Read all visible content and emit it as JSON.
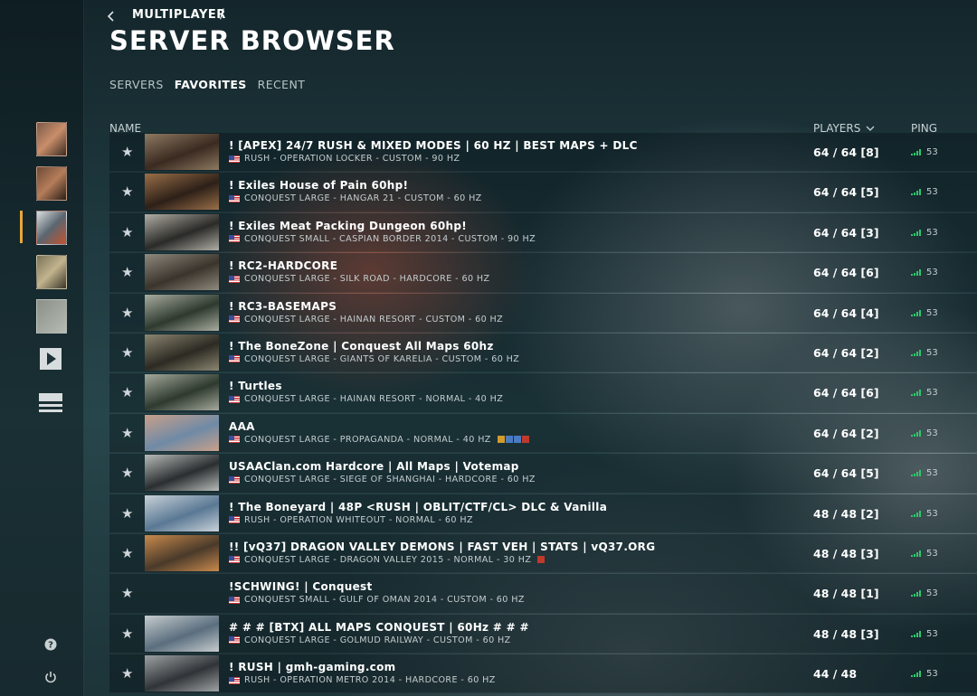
{
  "header": {
    "back_icon": "chevron-left-icon",
    "breadcrumb": "MULTIPLAYER",
    "breadcrumb_sep": "/",
    "title": "SERVER BROWSER"
  },
  "tabs": [
    {
      "label": "SERVERS",
      "active": false
    },
    {
      "label": "FAVORITES",
      "active": true
    },
    {
      "label": "RECENT",
      "active": false
    }
  ],
  "columns": {
    "name": "NAME",
    "players": "PLAYERS",
    "ping": "PING"
  },
  "sidebar": {
    "avatars": [
      {
        "name": "soldier-avatar-1",
        "color": "#7a5a4a"
      },
      {
        "name": "soldier-avatar-2",
        "color": "#6e4a38"
      },
      {
        "name": "soldier-avatar-3",
        "color": "#5a6670",
        "active": true
      },
      {
        "name": "soldier-avatar-4",
        "color": "#7b7258"
      },
      {
        "name": "emblem-avatar",
        "color": "#8a8f88"
      }
    ],
    "icons": [
      "play-icon",
      "menu-icon",
      "help-icon",
      "power-icon"
    ]
  },
  "servers": [
    {
      "name": "!  [APEX] 24/7 RUSH & MIXED MODES | 60 HZ | BEST MAPS + DLC",
      "meta": "RUSH - OPERATION LOCKER - CUSTOM - 90 HZ",
      "players": "64 / 64 [8]",
      "ping": "53",
      "thumb": [
        "#3a2a20",
        "#8d7a62"
      ]
    },
    {
      "name": "! Exiles House of Pain 60hp!",
      "meta": "CONQUEST LARGE - HANGAR 21 - CUSTOM - 60 HZ",
      "players": "64 / 64 [5]",
      "ping": "53",
      "thumb": [
        "#2d2018",
        "#9a6f48"
      ]
    },
    {
      "name": "! Exiles Meat Packing Dungeon 60hp!",
      "meta": "CONQUEST SMALL - CASPIAN BORDER 2014 - CUSTOM - 90 HZ",
      "players": "64 / 64 [3]",
      "ping": "53",
      "thumb": [
        "#2a2a28",
        "#b0aea4"
      ]
    },
    {
      "name": "! RC2-HARDCORE",
      "meta": "CONQUEST LARGE - SILK ROAD - HARDCORE - 60 HZ",
      "players": "64 / 64 [6]",
      "ping": "53",
      "thumb": [
        "#3a342c",
        "#8f8a7e"
      ]
    },
    {
      "name": "! RC3-BASEMAPS",
      "meta": "CONQUEST LARGE - HAINAN RESORT - CUSTOM - 60 HZ",
      "players": "64 / 64 [4]",
      "ping": "53",
      "thumb": [
        "#2e3a2e",
        "#a9aca0"
      ]
    },
    {
      "name": "! The BoneZone | Conquest All Maps 60hz",
      "meta": "CONQUEST LARGE - GIANTS OF KARELIA - CUSTOM - 60 HZ",
      "players": "64 / 64 [2]",
      "ping": "53",
      "thumb": [
        "#2c2a22",
        "#8c8672"
      ]
    },
    {
      "name": "! Turtles",
      "meta": "CONQUEST LARGE - HAINAN RESORT - NORMAL - 40 HZ",
      "players": "64 / 64 [6]",
      "ping": "53",
      "thumb": [
        "#2e3a2e",
        "#a6a99d"
      ]
    },
    {
      "name": "AAA",
      "meta": "CONQUEST LARGE - PROPAGANDA - NORMAL - 40 HZ",
      "players": "64 / 64 [2]",
      "ping": "53",
      "thumb": [
        "#6f8aa6",
        "#c9a08a"
      ],
      "badges": 4
    },
    {
      "name": "USAAClan.com Hardcore | All Maps | Votemap",
      "meta": "CONQUEST LARGE - SIEGE OF SHANGHAI - HARDCORE - 60 HZ",
      "players": "64 / 64 [5]",
      "ping": "53",
      "thumb": [
        "#2a2e30",
        "#b7bbb8"
      ]
    },
    {
      "name": "! The Boneyard | 48P <RUSH | OBLIT/CTF/CL> DLC & Vanilla",
      "meta": "RUSH - OPERATION WHITEOUT - NORMAL - 60 HZ",
      "players": "48 / 48 [2]",
      "ping": "53",
      "thumb": [
        "#5a7894",
        "#c8d2d8"
      ]
    },
    {
      "name": "!! [vQ37] DRAGON VALLEY DEMONS | FAST VEH | STATS | vQ37.ORG",
      "meta": "CONQUEST LARGE - DRAGON VALLEY 2015 - NORMAL - 30 HZ",
      "players": "48 / 48 [3]",
      "ping": "53",
      "thumb": [
        "#4a3a2a",
        "#c98a4c"
      ],
      "badges": 1
    },
    {
      "name": "!SCHWING! | Conquest",
      "meta": "CONQUEST SMALL - GULF OF OMAN 2014 - CUSTOM - 60 HZ",
      "players": "48 / 48 [1]",
      "ping": "53",
      "thumb": null
    },
    {
      "name": "# # # [BTX] ALL MAPS CONQUEST | 60Hz # # #",
      "meta": "CONQUEST LARGE - GOLMUD RAILWAY - CUSTOM - 60 HZ",
      "players": "48 / 48 [3]",
      "ping": "53",
      "thumb": [
        "#5a6e7e",
        "#c6ccce"
      ]
    },
    {
      "name": "! RUSH | gmh-gaming.com",
      "meta": "RUSH - OPERATION METRO 2014 - HARDCORE - 60 HZ",
      "players": "44 / 48",
      "ping": "53",
      "thumb": [
        "#303438",
        "#9ea2a4"
      ]
    }
  ],
  "colors": {
    "accent": "#e8a63a",
    "ping_bar": "#2ec66a",
    "badge": "#d39a2e",
    "badge_red": "#c0392b"
  }
}
